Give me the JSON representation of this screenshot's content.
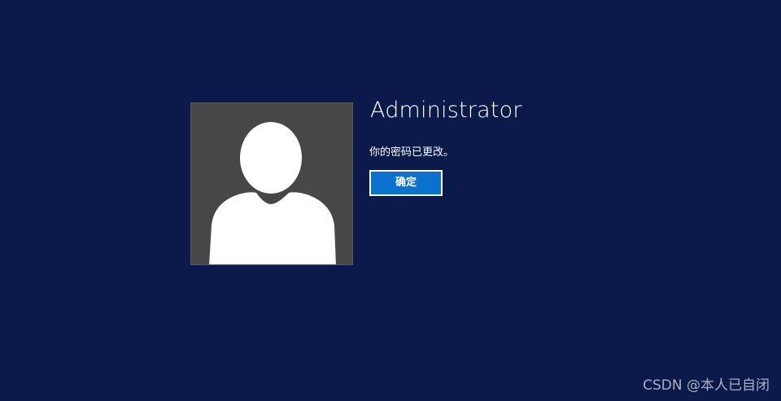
{
  "user": {
    "name": "Administrator",
    "avatar_icon": "default-user-avatar-icon"
  },
  "dialog": {
    "message": "你的密码已更改。",
    "ok_label": "确定"
  },
  "watermark": {
    "text": "CSDN @本人已自闭"
  },
  "colors": {
    "background": "#0b1a4a",
    "avatar_background": "#474747",
    "button_accent": "#0a72cc"
  }
}
